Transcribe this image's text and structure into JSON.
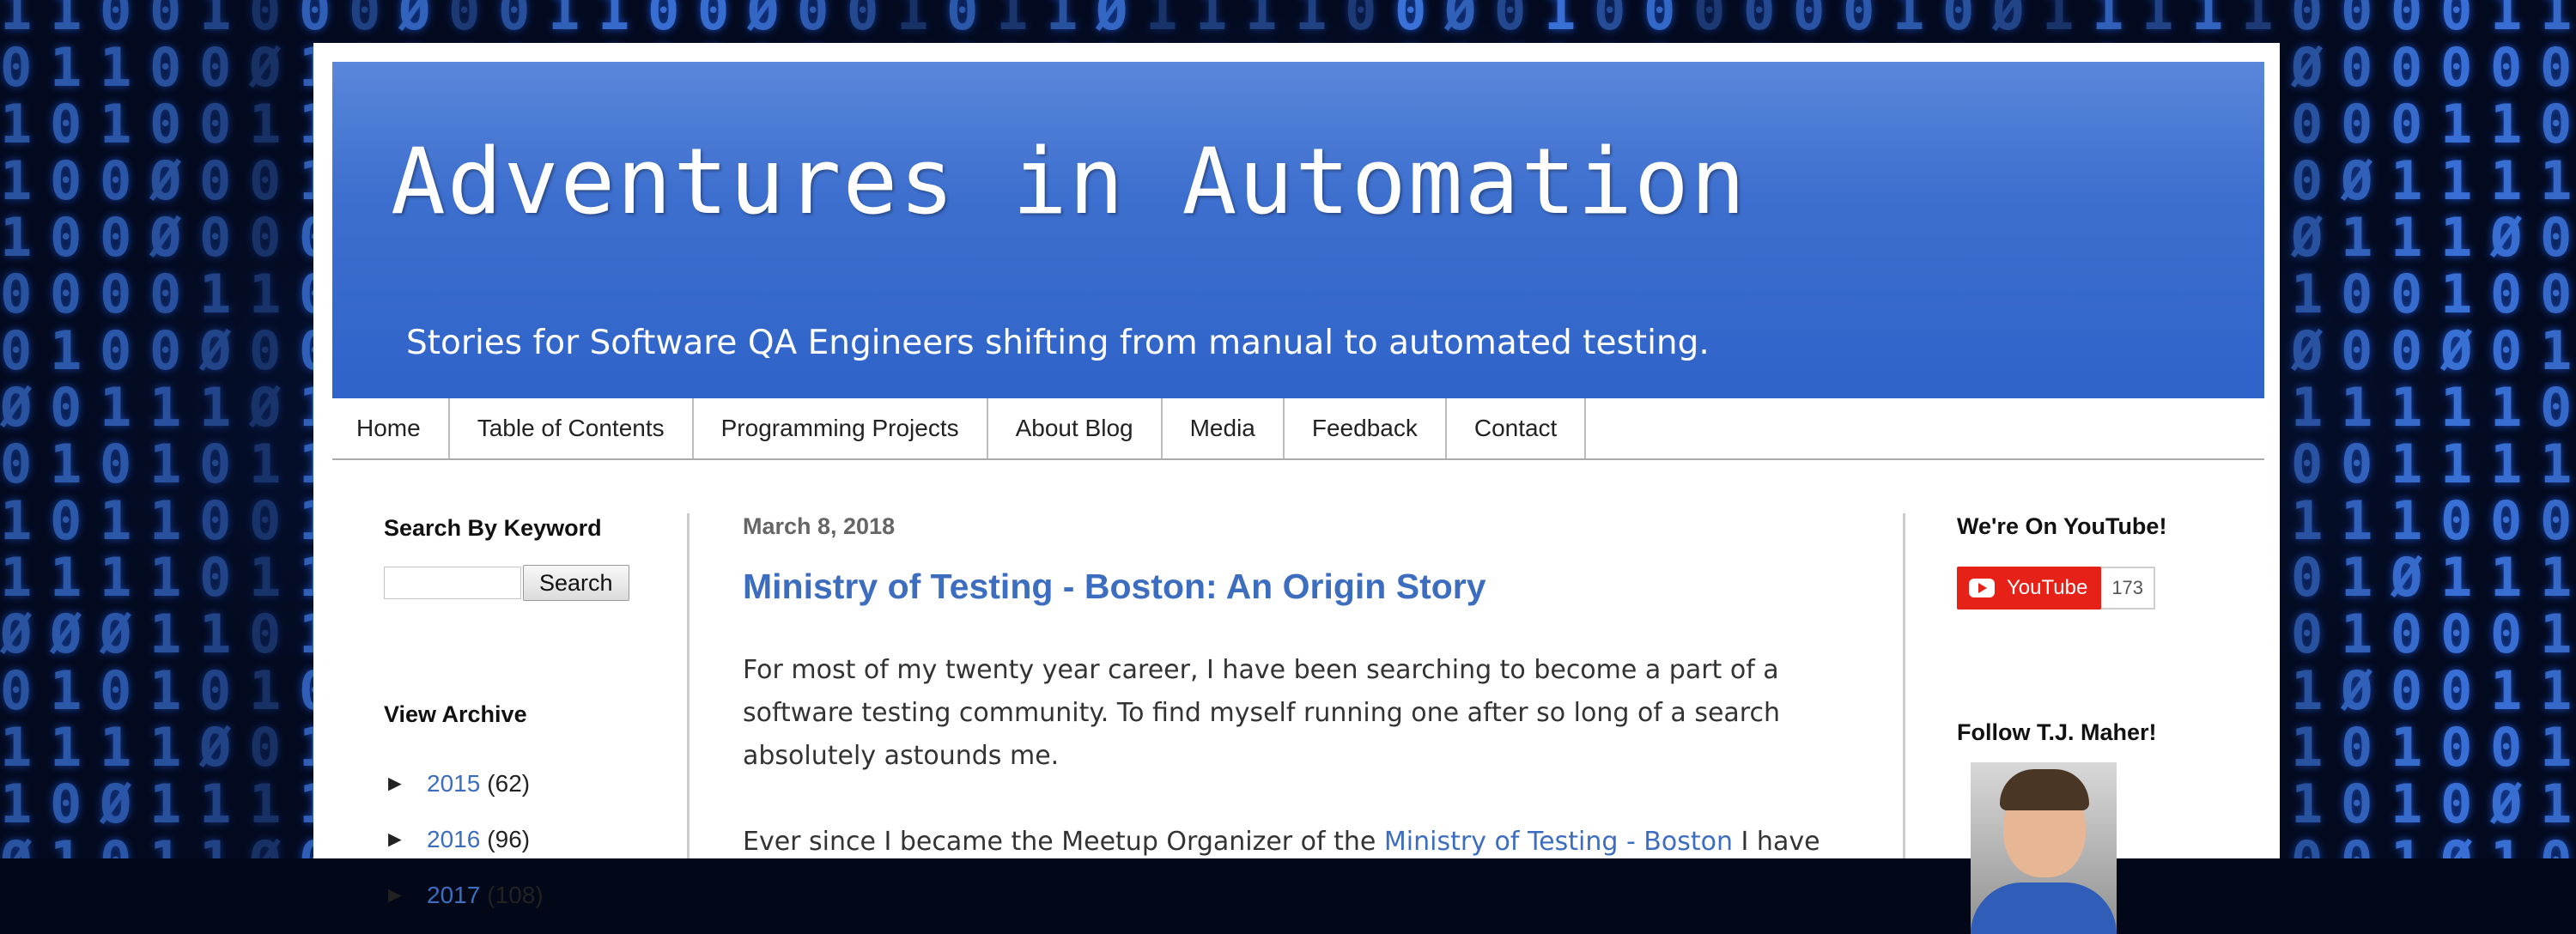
{
  "blog": {
    "title": "Adventures in Automation",
    "description": "Stories for Software QA Engineers shifting from manual to automated testing."
  },
  "nav": {
    "tabs": [
      "Home",
      "Table of Contents",
      "Programming Projects",
      "About Blog",
      "Media",
      "Feedback",
      "Contact"
    ]
  },
  "sidebar_left": {
    "search_title": "Search By Keyword",
    "search_placeholder": "",
    "search_button": "Search",
    "archive_title": "View Archive",
    "archive": [
      {
        "year": "2015",
        "count": "(62)"
      },
      {
        "year": "2016",
        "count": "(96)"
      },
      {
        "year": "2017",
        "count": "(108)"
      }
    ]
  },
  "post": {
    "date": "March 8, 2018",
    "title": "Ministry of Testing - Boston: An Origin Story",
    "paragraph1": "For most of my twenty year career, I have been searching to become a part of a software testing community. To find myself running one after so long of a search absolutely astounds me.",
    "paragraph2_start": "Ever since I became the Meetup Organizer of the ",
    "paragraph2_link": "Ministry of Testing - Boston",
    "paragraph2_end": " I have"
  },
  "sidebar_right": {
    "youtube_title": "We're On YouTube!",
    "youtube_button": "YouTube",
    "youtube_count": "173",
    "follow_title": "Follow T.J. Maher!"
  },
  "colors": {
    "header_blue": "#3d6fcf",
    "link_blue": "#3d6dbf",
    "youtube_red": "#e62117"
  }
}
